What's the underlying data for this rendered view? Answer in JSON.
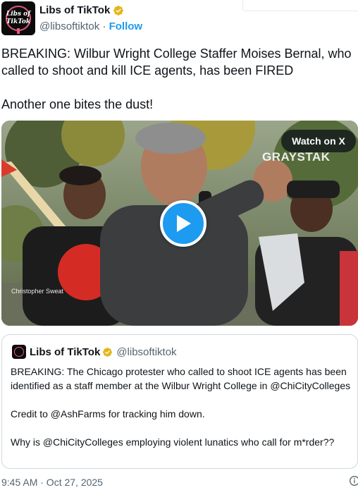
{
  "author": {
    "display_name": "Libs of TikTok",
    "handle": "@libsoftiktok",
    "separator": "·",
    "follow_label": "Follow",
    "avatar_text": "Libs of TikTok",
    "verified_icon": "verified-badge-gold"
  },
  "tweet": {
    "text_line1": "BREAKING: Wilbur Wright College Staffer Moises Bernal, who called to shoot and kill ICE agents, has been FIRED",
    "text_line2": "Another one bites the dust!"
  },
  "media": {
    "watch_label": "Watch on X",
    "watermark": "GRAYSTAK",
    "credit": "Christopher Sweat",
    "play_icon": "play-icon"
  },
  "quote": {
    "display_name": "Libs of TikTok",
    "handle": "@libsoftiktok",
    "paragraph1": "BREAKING: The Chicago protester who called to shoot ICE agents has been identified as a staff member at the Wilbur Wright College in @ChiCityColleges",
    "paragraph2": "Credit to @AshFarms for tracking him down.",
    "paragraph3": "Why is @ChiCityColleges employing violent lunatics who call for m*rder??"
  },
  "footer": {
    "timestamp": "9:45 AM · Oct 27, 2025",
    "info_icon": "info-icon"
  },
  "colors": {
    "accent": "#1d9bf0",
    "verified": "#e2b719",
    "secondary_text": "#536471",
    "border": "#cfd9de"
  }
}
